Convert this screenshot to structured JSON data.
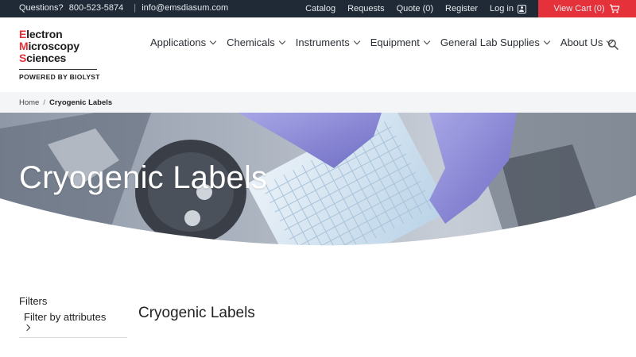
{
  "topbar": {
    "questions_label": "Questions?",
    "phone": "800-523-5874",
    "separator": "|",
    "email": "info@emsdiasum.com",
    "links": {
      "catalog": "Catalog",
      "requests": "Requests",
      "quote": "Quote (0)",
      "register": "Register",
      "login": "Log in"
    },
    "cart_label": "View Cart (0)",
    "bar_color": "#1f2a36",
    "cart_color": "#e5323a"
  },
  "logo": {
    "line1_initial": "E",
    "line1_rest": "lectron",
    "line2_initial": "M",
    "line2_rest": "icroscopy",
    "line3_initial": "S",
    "line3_rest": "ciences",
    "powered_by": "POWERED BY BIOLYST"
  },
  "nav": {
    "items": [
      {
        "label": "Applications"
      },
      {
        "label": "Chemicals"
      },
      {
        "label": "Instruments"
      },
      {
        "label": "Equipment"
      },
      {
        "label": "General Lab Supplies"
      },
      {
        "label": "About Us"
      }
    ],
    "search_icon": "search-icon"
  },
  "breadcrumb": {
    "home": "Home",
    "separator": "/",
    "current": "Cryogenic Labels"
  },
  "hero": {
    "title": "Cryogenic Labels"
  },
  "sidebar": {
    "filters_title": "Filters",
    "filter_by_attributes": "Filter by attributes"
  },
  "main": {
    "heading": "Cryogenic Labels"
  }
}
